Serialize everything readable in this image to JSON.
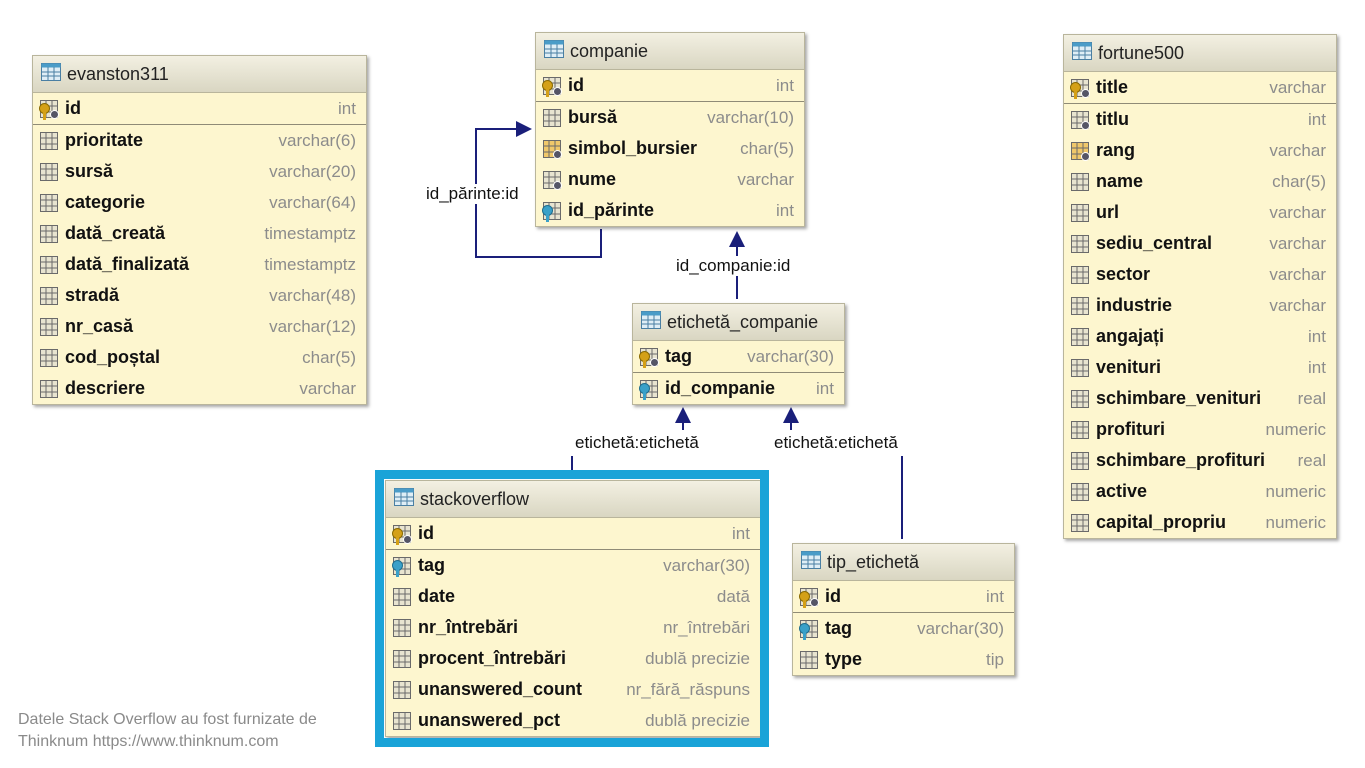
{
  "tables": {
    "evanston311": {
      "name": "evanston311",
      "columns": [
        {
          "name": "id",
          "type": "int",
          "icon": "primary-key-icon"
        },
        {
          "name": "prioritate",
          "type": "varchar(6)",
          "icon": "column-icon"
        },
        {
          "name": "sursă",
          "type": "varchar(20)",
          "icon": "column-icon"
        },
        {
          "name": "categorie",
          "type": "varchar(64)",
          "icon": "column-icon"
        },
        {
          "name": "dată_creată",
          "type": "timestamptz",
          "icon": "column-icon"
        },
        {
          "name": "dată_finalizată",
          "type": "timestamptz",
          "icon": "column-icon"
        },
        {
          "name": "stradă",
          "type": "varchar(48)",
          "icon": "column-icon"
        },
        {
          "name": "nr_casă",
          "type": "varchar(12)",
          "icon": "column-icon"
        },
        {
          "name": "cod_poștal",
          "type": "char(5)",
          "icon": "column-icon"
        },
        {
          "name": "descriere",
          "type": "varchar",
          "icon": "column-icon"
        }
      ]
    },
    "companie": {
      "name": "companie",
      "columns": [
        {
          "name": "id",
          "type": "int",
          "icon": "primary-key-icon"
        },
        {
          "name": "bursă",
          "type": "varchar(10)",
          "icon": "column-icon"
        },
        {
          "name": "simbol_bursier",
          "type": "char(5)",
          "icon": "unique-column-icon"
        },
        {
          "name": "nume",
          "type": "varchar",
          "icon": "not-null-column-icon"
        },
        {
          "name": "id_părinte",
          "type": "int",
          "icon": "foreign-key-icon"
        }
      ]
    },
    "eticheta_companie": {
      "name": "etichetă_companie",
      "columns": [
        {
          "name": "tag",
          "type": "varchar(30)",
          "icon": "primary-key-icon"
        },
        {
          "name": "id_companie",
          "type": "int",
          "icon": "foreign-key-icon"
        }
      ]
    },
    "stackoverflow": {
      "name": "stackoverflow",
      "columns": [
        {
          "name": "id",
          "type": "int",
          "icon": "primary-key-icon"
        },
        {
          "name": "tag",
          "type": "varchar(30)",
          "icon": "foreign-key-icon"
        },
        {
          "name": "date",
          "type": "dată",
          "icon": "column-icon"
        },
        {
          "name": "nr_întrebări",
          "type": "nr_întrebări",
          "icon": "column-icon"
        },
        {
          "name": "procent_întrebări",
          "type": "dublă precizie",
          "icon": "column-icon"
        },
        {
          "name": "unanswered_count",
          "type": "nr_fără_răspuns",
          "icon": "column-icon"
        },
        {
          "name": "unanswered_pct",
          "type": "dublă precizie",
          "icon": "column-icon"
        }
      ]
    },
    "tip_eticheta": {
      "name": "tip_etichetă",
      "columns": [
        {
          "name": "id",
          "type": "int",
          "icon": "primary-key-icon"
        },
        {
          "name": "tag",
          "type": "varchar(30)",
          "icon": "foreign-key-icon"
        },
        {
          "name": "type",
          "type": "tip",
          "icon": "column-icon"
        }
      ]
    },
    "fortune500": {
      "name": "fortune500",
      "columns": [
        {
          "name": "title",
          "type": "varchar",
          "icon": "primary-key-icon"
        },
        {
          "name": "titlu",
          "type": "int",
          "icon": "not-null-column-icon"
        },
        {
          "name": "rang",
          "type": "varchar",
          "icon": "unique-column-icon"
        },
        {
          "name": "name",
          "type": "char(5)",
          "icon": "column-icon"
        },
        {
          "name": "url",
          "type": "varchar",
          "icon": "column-icon"
        },
        {
          "name": "sediu_central",
          "type": "varchar",
          "icon": "column-icon"
        },
        {
          "name": "sector",
          "type": "varchar",
          "icon": "column-icon"
        },
        {
          "name": "industrie",
          "type": "varchar",
          "icon": "column-icon"
        },
        {
          "name": "angajați",
          "type": "int",
          "icon": "column-icon"
        },
        {
          "name": "venituri",
          "type": "int",
          "icon": "column-icon"
        },
        {
          "name": "schimbare_venituri",
          "type": "real",
          "icon": "column-icon"
        },
        {
          "name": "profituri",
          "type": "numeric",
          "icon": "column-icon"
        },
        {
          "name": "schimbare_profituri",
          "type": "real",
          "icon": "column-icon"
        },
        {
          "name": "active",
          "type": "numeric",
          "icon": "column-icon"
        },
        {
          "name": "capital_propriu",
          "type": "numeric",
          "icon": "column-icon"
        }
      ]
    }
  },
  "relations": {
    "self_parent": "id_părinte:id",
    "company_id": "id_companie:id",
    "tag_left": "etichetă:etichetă",
    "tag_right": "etichetă:etichetă"
  },
  "footnote": {
    "line1": "Datele Stack Overflow au fost furnizate de",
    "line2": "Thinknum https://www.thinknum.com"
  },
  "colors": {
    "table_bg": "#fdf6cf",
    "relation_line": "#1a1f7a",
    "highlight": "#1aa3d8",
    "pk_key": "#d4a017",
    "fk_key": "#3aa0c8"
  }
}
